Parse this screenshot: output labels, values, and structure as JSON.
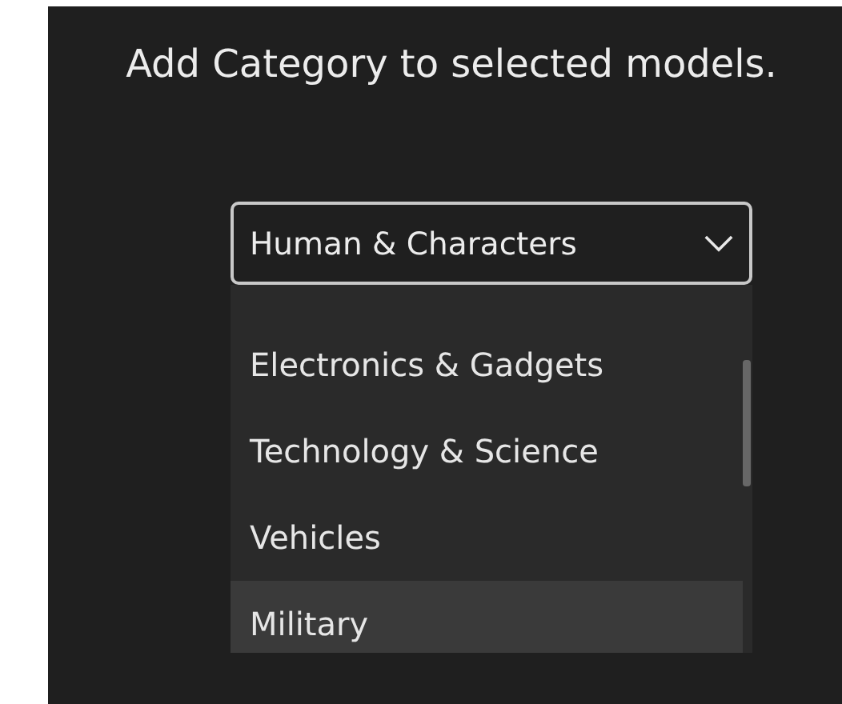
{
  "prompt": "Add Category to selected models.",
  "dropdown": {
    "value": "Human & Characters",
    "expanded": true
  },
  "options": [
    {
      "label": "Electronics & Gadgets",
      "selected": false
    },
    {
      "label": "Technology & Science",
      "selected": false
    },
    {
      "label": "Vehicles",
      "selected": false
    },
    {
      "label": "Military",
      "selected": true
    }
  ]
}
